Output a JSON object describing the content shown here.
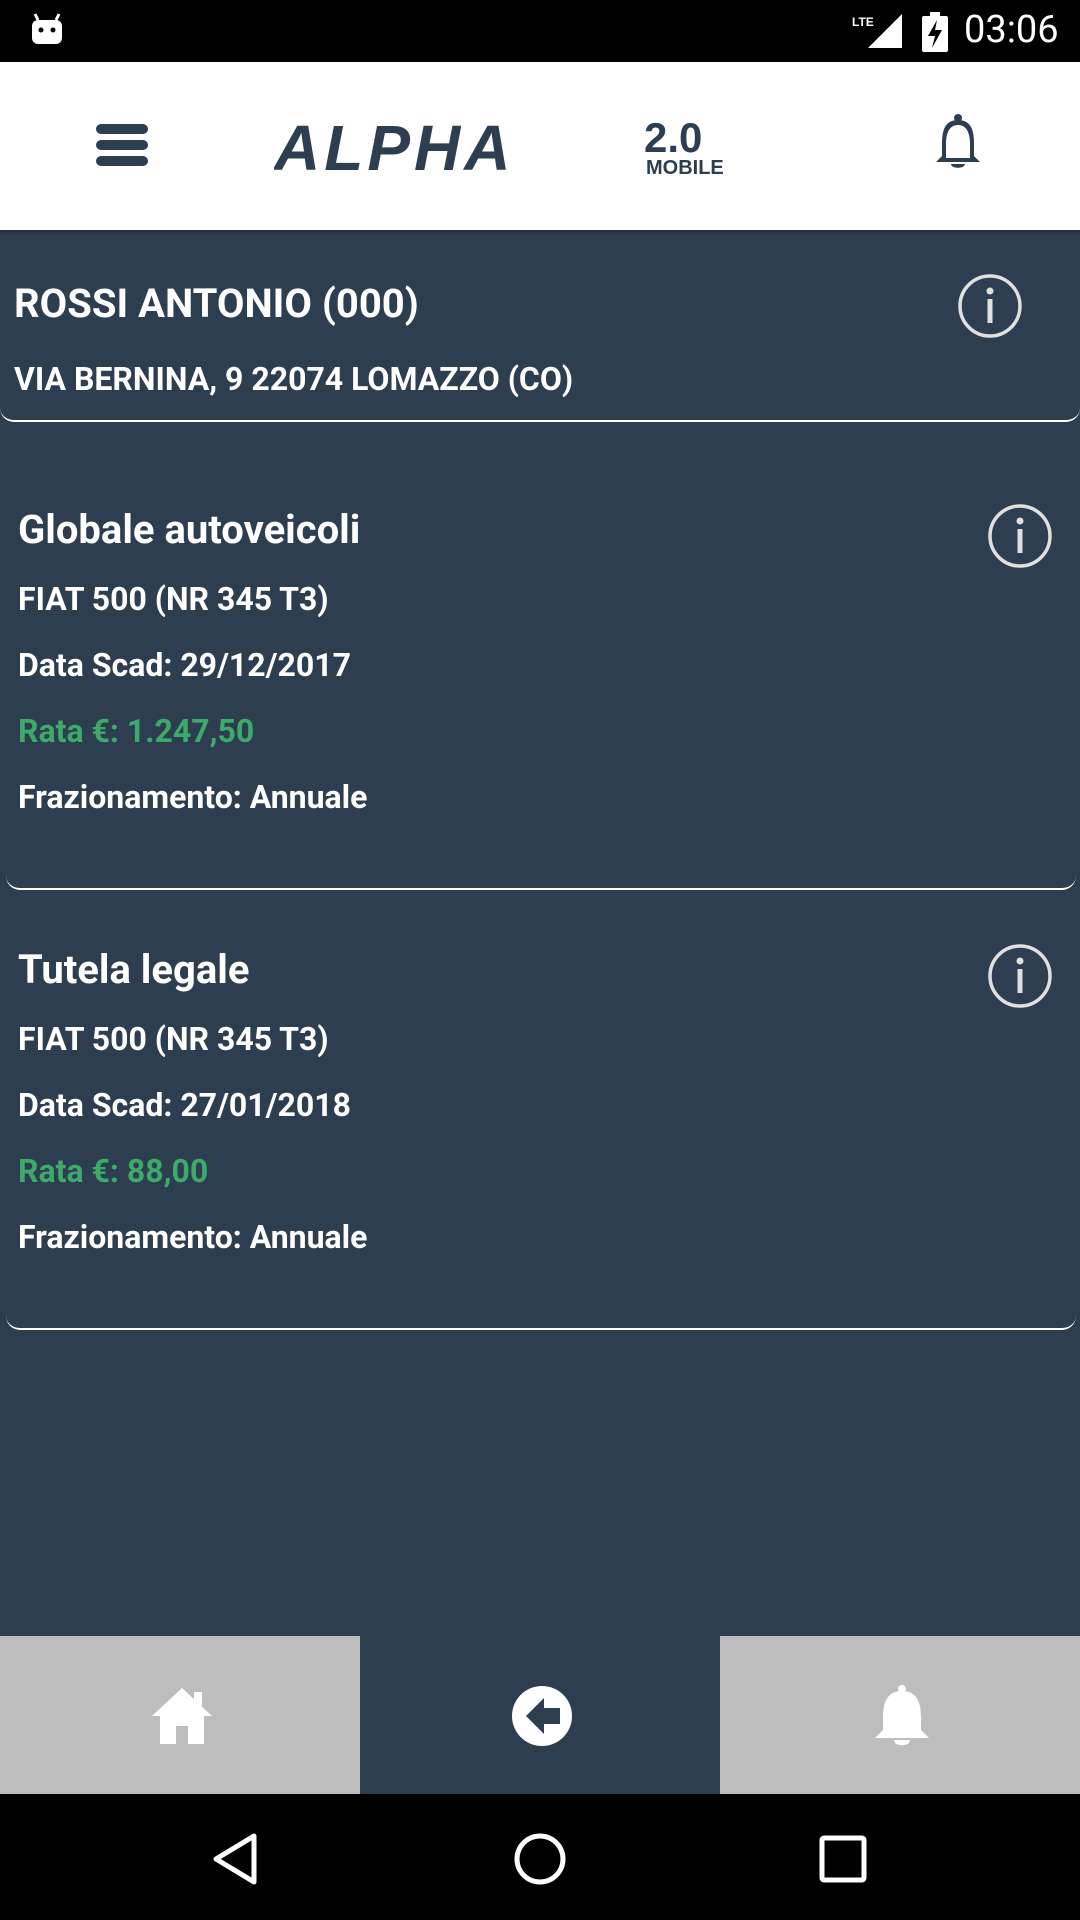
{
  "status_bar": {
    "time": "03:06",
    "network": "LTE"
  },
  "header": {
    "logo_text": "ALPHA",
    "logo_version": "2.0",
    "logo_sub": "MOBILE"
  },
  "customer": {
    "name": "ROSSI ANTONIO (000)",
    "address": "VIA BERNINA, 9 22074 LOMAZZO (CO)"
  },
  "policies": [
    {
      "title": "Globale autoveicoli",
      "vehicle": "FIAT 500 (NR 345 T3)",
      "expiry": "Data Scad: 29/12/2017",
      "rate": "Rata €: 1.247,50",
      "frequency": "Frazionamento: Annuale"
    },
    {
      "title": "Tutela legale",
      "vehicle": "FIAT 500 (NR 345 T3)",
      "expiry": "Data Scad: 27/01/2018",
      "rate": "Rata €: 88,00",
      "frequency": "Frazionamento: Annuale"
    }
  ],
  "bottom_nav": {
    "items": [
      "home-icon",
      "back-arrow-icon",
      "bell-icon"
    ]
  },
  "colors": {
    "background": "#2e3e51",
    "rate_green": "#3daa6a",
    "nav_gray": "#bdbdbd"
  }
}
